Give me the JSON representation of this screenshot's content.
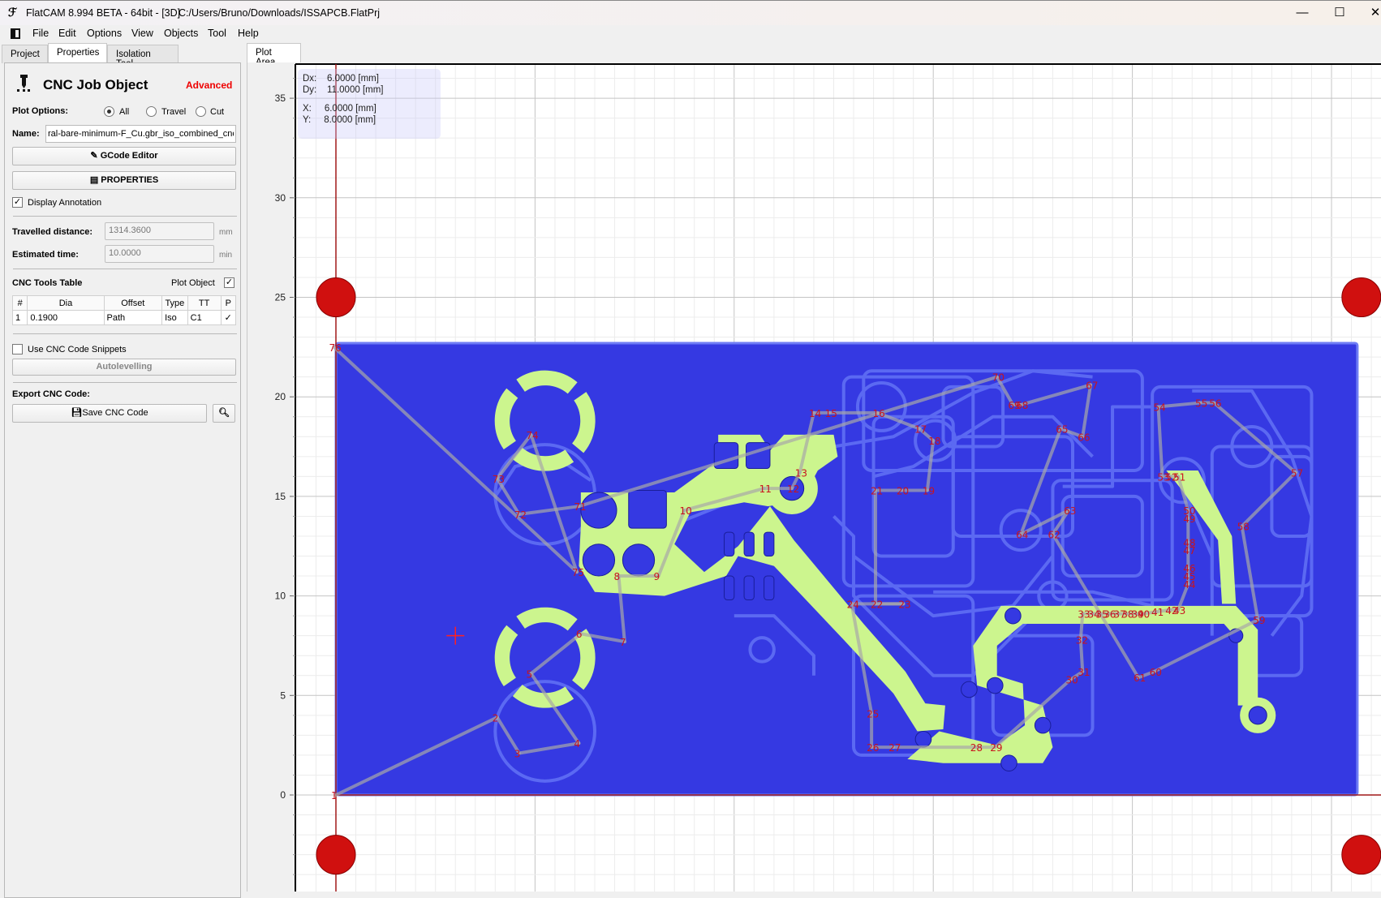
{
  "window": {
    "title": "FlatCAM 8.994 BETA - 64bit - [3D]",
    "path": "C:/Users/Bruno/Downloads/ISSAPCB.FlatPrj",
    "minimize": "—",
    "maximize": "☐",
    "close": "✕"
  },
  "menu": [
    "File",
    "Edit",
    "Options",
    "View",
    "Objects",
    "Tool",
    "Help"
  ],
  "left_tabs": [
    "Project",
    "Properties",
    "Isolation Tool"
  ],
  "active_left_tab": "Properties",
  "plot_tab": "Plot Area",
  "panel": {
    "title": "CNC Job Object",
    "mode": "Advanced",
    "plot_options_label": "Plot Options:",
    "plot_options": [
      "All",
      "Travel",
      "Cut"
    ],
    "plot_option_selected": "All",
    "name_label": "Name:",
    "name_value": "ral-bare-minimum-F_Cu.gbr_iso_combined_cnc",
    "gcode_editor": "GCode Editor",
    "properties": "PROPERTIES",
    "display_annotation": "Display Annotation",
    "display_annotation_checked": true,
    "travelled_label": "Travelled distance:",
    "travelled_value": "1314.3600",
    "travelled_unit": "mm",
    "time_label": "Estimated time:",
    "time_value": "10.0000",
    "time_unit": "min",
    "tools_table_label": "CNC Tools Table",
    "plot_object_label": "Plot Object",
    "plot_object_checked": true,
    "table_headers": [
      "#",
      "Dia",
      "Offset",
      "Type",
      "TT",
      "P"
    ],
    "table_rows": [
      [
        "1",
        "0.1900",
        "Path",
        "Iso",
        "C1",
        "✓"
      ]
    ],
    "snippets_label": "Use CNC Code Snippets",
    "snippets_checked": false,
    "autolevelling": "Autolevelling",
    "export_label": "Export CNC Code:",
    "save_cnc": "Save CNC Code"
  },
  "readout": {
    "dx": "Dx:    6.0000 [mm]",
    "dy": "Dy:    11.0000 [mm]",
    "x": "X:     6.0000 [mm]",
    "y": "Y:     8.0000 [mm]"
  },
  "plot": {
    "y_ticks": [
      "35",
      "30",
      "25",
      "20",
      "15",
      "10",
      "5",
      "0"
    ],
    "x_major_step_mm": 10,
    "y_major_step_mm": 5,
    "colors": {
      "board": "#3539e2",
      "copper": "#ccf58e",
      "isolation": "#5e6cf3",
      "travel": "#a8a8a8",
      "annotation": "#c8141e",
      "marker": "#d0100f",
      "axis": "#a01818"
    },
    "board_extent_mm": {
      "x": [
        0,
        51.3
      ],
      "y": [
        0,
        22.7
      ]
    },
    "markers_mm": [
      [
        0,
        25
      ],
      [
        51.5,
        25
      ],
      [
        0,
        -3
      ],
      [
        51.5,
        -3
      ]
    ],
    "cursor_mm": [
      6,
      8
    ],
    "path_points": [
      [
        "1",
        0,
        0
      ],
      [
        "2",
        8.1,
        3.9
      ],
      [
        "3",
        9.2,
        2.1
      ],
      [
        "4",
        12.2,
        2.6
      ],
      [
        "5",
        9.8,
        6.1
      ],
      [
        "6",
        12.3,
        8.1
      ],
      [
        "7",
        14.5,
        7.7
      ],
      [
        "8",
        14.2,
        11.0
      ],
      [
        "9",
        16.2,
        11.0
      ],
      [
        "10",
        17.5,
        14.3
      ],
      [
        "11",
        21.5,
        15.4
      ],
      [
        "12",
        22.9,
        15.4
      ],
      [
        "13",
        23.3,
        16.2
      ],
      [
        "14",
        24.0,
        19.2
      ],
      [
        "15",
        24.8,
        19.2
      ],
      [
        "16",
        27.2,
        19.2
      ],
      [
        "17",
        29.3,
        18.4
      ],
      [
        "18",
        30.0,
        17.8
      ],
      [
        "19",
        29.7,
        15.3
      ],
      [
        "20",
        28.4,
        15.3
      ],
      [
        "21",
        27.1,
        15.3
      ],
      [
        "22",
        27.1,
        9.6
      ],
      [
        "23",
        28.5,
        9.6
      ],
      [
        "24",
        25.9,
        9.6
      ],
      [
        "25",
        26.9,
        4.1
      ],
      [
        "26",
        26.9,
        2.4
      ],
      [
        "27",
        28.0,
        2.4
      ],
      [
        "28",
        32.1,
        2.4
      ],
      [
        "29",
        33.1,
        2.4
      ],
      [
        "30",
        36.9,
        5.8
      ],
      [
        "31",
        37.5,
        6.2
      ],
      [
        "32",
        37.4,
        7.8
      ],
      [
        "33",
        37.5,
        9.1
      ],
      [
        "34",
        38.0,
        9.1
      ],
      [
        "35",
        38.4,
        9.1
      ],
      [
        "36",
        38.8,
        9.1
      ],
      [
        "37",
        39.3,
        9.1
      ],
      [
        "38",
        39.7,
        9.1
      ],
      [
        "39",
        40.2,
        9.1
      ],
      [
        "40",
        40.5,
        9.1
      ],
      [
        "41",
        41.2,
        9.2
      ],
      [
        "42",
        41.9,
        9.3
      ],
      [
        "43",
        42.3,
        9.3
      ],
      [
        "44",
        42.8,
        10.6
      ],
      [
        "45",
        42.8,
        11.0
      ],
      [
        "46",
        42.8,
        11.4
      ],
      [
        "47",
        42.8,
        12.3
      ],
      [
        "48",
        42.8,
        12.7
      ],
      [
        "49",
        42.8,
        13.9
      ],
      [
        "50",
        42.8,
        14.3
      ],
      [
        "51",
        42.3,
        16.0
      ],
      [
        "52",
        41.9,
        16.0
      ],
      [
        "53",
        41.5,
        16.0
      ],
      [
        "54",
        41.3,
        19.5
      ],
      [
        "55",
        43.4,
        19.7
      ],
      [
        "56",
        44.1,
        19.7
      ],
      [
        "57",
        48.2,
        16.2
      ],
      [
        "58",
        45.5,
        13.5
      ],
      [
        "59",
        46.3,
        8.8
      ],
      [
        "60",
        41.1,
        6.2
      ],
      [
        "61",
        40.3,
        5.9
      ],
      [
        "62",
        36.0,
        13.1
      ],
      [
        "63",
        36.8,
        14.3
      ],
      [
        "64",
        34.4,
        13.1
      ],
      [
        "65",
        36.4,
        18.4
      ],
      [
        "66",
        37.5,
        18.0
      ],
      [
        "67",
        37.9,
        20.6
      ],
      [
        "68",
        34.4,
        19.6
      ],
      [
        "69",
        34.0,
        19.6
      ],
      [
        "70",
        33.2,
        21.0
      ],
      [
        "71",
        12.2,
        14.5
      ],
      [
        "72",
        9.2,
        14.1
      ],
      [
        "73",
        8.1,
        15.9
      ],
      [
        "74",
        9.8,
        18.1
      ],
      [
        "75",
        12.1,
        11.2
      ],
      [
        "76",
        -0.1,
        22.5
      ]
    ]
  }
}
